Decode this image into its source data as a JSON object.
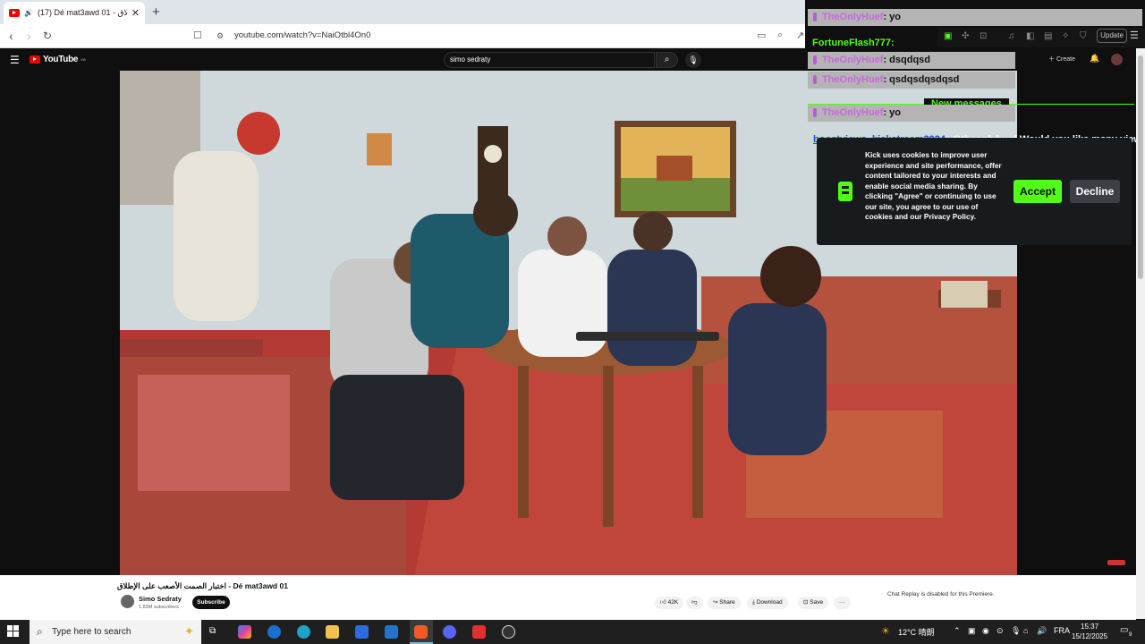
{
  "browser": {
    "tab_title": "(17) Dé mat3awd 01 - الإطلاق",
    "tab_close": "✕",
    "new_tab": "+",
    "url": "youtube.com/watch?v=NaiOtbl4On0",
    "update_label": "Update"
  },
  "youtube": {
    "logo_text": "YouTube",
    "logo_region": "MA",
    "search_query": "simo sedraty",
    "create_label": "Create",
    "notification_count": "9+",
    "video": {
      "title": "اختبار الصمت الأصعب على الإطلاق - Dé mat3awd 01",
      "channel_name": "Simo Sedraty",
      "subscribers": "1.83M subscribers",
      "subscribe_label": "Subscribe",
      "likes": "42K",
      "share_label": "Share",
      "download_label": "Download",
      "save_label": "Save",
      "more_label": "···"
    },
    "chat_replay_note": "Chat Replay is disabled for this Premiere."
  },
  "chat_overlay": {
    "messages": [
      {
        "user": "TheOnlyHuef",
        "text": ": yo"
      },
      {
        "user": "TheOnlyHuef",
        "text": ": dsqdqsd"
      },
      {
        "user": "TheOnlyHuef",
        "text": ": qsdqsdqsdqsd"
      },
      {
        "user": "TheOnlyHuef",
        "text": ": yo"
      }
    ],
    "fortune_user": "FortuneFlash777:",
    "new_messages_label": "New messages",
    "bottom_user": "boostviews_kickstream2024",
    "bottom_text": ": @theonlyhuef Would you like many viewers?"
  },
  "cookie_banner": {
    "text": "Kick uses cookies to improve user experience and site performance, offer content tailored to your interests and enable social media sharing. By clicking \"Agree\" or continuing to use our site, you agree to our use of cookies and our Privacy Policy.",
    "accept_label": "Accept",
    "decline_label": "Decline"
  },
  "taskbar": {
    "search_placeholder": "Type here to search",
    "weather": "12°C 晴朗",
    "language": "FRA",
    "time": "15:37",
    "date": "15/12/2025",
    "notifications": "9"
  },
  "colors": {
    "kick_green": "#53fc18",
    "youtube_red": "#ff0000",
    "chat_bg": "#b4b4b4"
  }
}
